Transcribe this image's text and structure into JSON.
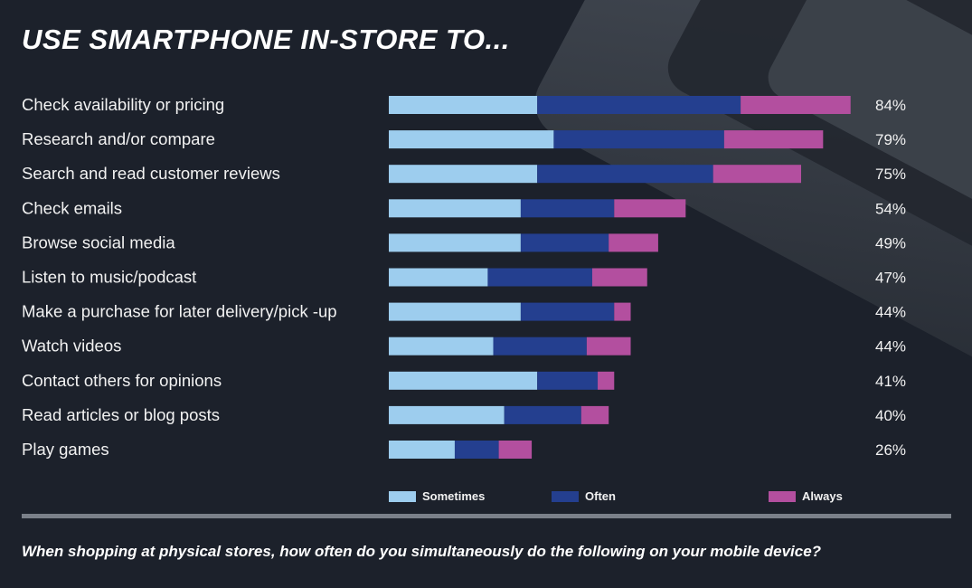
{
  "title": "USE SMARTPHONE IN-STORE TO...",
  "footnote": "When shopping at physical stores, how often do you simultaneously do the following on your mobile device?",
  "colors": {
    "sometimes": "#9dcdee",
    "often": "#243f8f",
    "always": "#b34f9f",
    "text": "#f2f2f2",
    "background": "#1c212b"
  },
  "chart_data": {
    "type": "bar",
    "orientation": "horizontal",
    "stacked": true,
    "title": "USE SMARTPHONE IN-STORE TO...",
    "xlabel": "",
    "ylabel": "",
    "xlim": [
      0,
      100
    ],
    "grid": false,
    "legend": {
      "position": "bottom",
      "entries": [
        "Sometimes",
        "Often",
        "Always"
      ]
    },
    "categories": [
      "Check availability or pricing",
      "Research and/or compare",
      "Search and read customer reviews",
      "Check emails",
      "Browse social media",
      "Listen to music/podcast",
      "Make a purchase for later delivery/pick -up",
      "Watch videos",
      "Contact others for opinions",
      "Read articles or blog posts",
      "Play games"
    ],
    "series": [
      {
        "name": "Sometimes",
        "values": [
          27,
          30,
          27,
          24,
          24,
          18,
          24,
          19,
          27,
          21,
          12
        ]
      },
      {
        "name": "Often",
        "values": [
          37,
          31,
          32,
          17,
          16,
          19,
          17,
          17,
          11,
          14,
          8
        ]
      },
      {
        "name": "Always",
        "values": [
          20,
          18,
          16,
          13,
          9,
          10,
          3,
          8,
          3,
          5,
          6
        ]
      }
    ],
    "totals": [
      "84%",
      "79%",
      "75%",
      "54%",
      "49%",
      "47%",
      "44%",
      "44%",
      "41%",
      "40%",
      "26%"
    ]
  }
}
